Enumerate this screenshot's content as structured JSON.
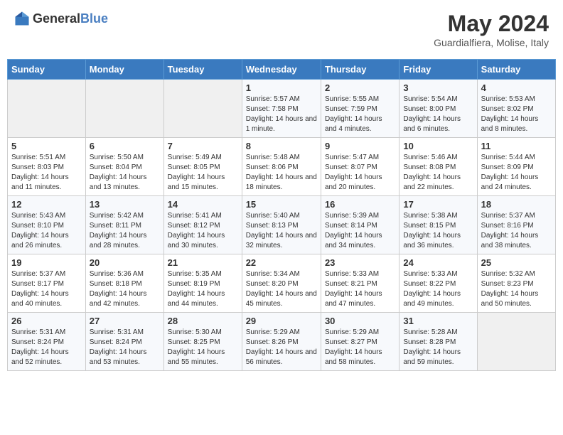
{
  "header": {
    "logo_general": "General",
    "logo_blue": "Blue",
    "title": "May 2024",
    "subtitle": "Guardialfiera, Molise, Italy"
  },
  "days_of_week": [
    "Sunday",
    "Monday",
    "Tuesday",
    "Wednesday",
    "Thursday",
    "Friday",
    "Saturday"
  ],
  "weeks": [
    [
      {
        "day": "",
        "info": ""
      },
      {
        "day": "",
        "info": ""
      },
      {
        "day": "",
        "info": ""
      },
      {
        "day": "1",
        "info": "Sunrise: 5:57 AM\nSunset: 7:58 PM\nDaylight: 14 hours and 1 minute."
      },
      {
        "day": "2",
        "info": "Sunrise: 5:55 AM\nSunset: 7:59 PM\nDaylight: 14 hours and 4 minutes."
      },
      {
        "day": "3",
        "info": "Sunrise: 5:54 AM\nSunset: 8:00 PM\nDaylight: 14 hours and 6 minutes."
      },
      {
        "day": "4",
        "info": "Sunrise: 5:53 AM\nSunset: 8:02 PM\nDaylight: 14 hours and 8 minutes."
      }
    ],
    [
      {
        "day": "5",
        "info": "Sunrise: 5:51 AM\nSunset: 8:03 PM\nDaylight: 14 hours and 11 minutes."
      },
      {
        "day": "6",
        "info": "Sunrise: 5:50 AM\nSunset: 8:04 PM\nDaylight: 14 hours and 13 minutes."
      },
      {
        "day": "7",
        "info": "Sunrise: 5:49 AM\nSunset: 8:05 PM\nDaylight: 14 hours and 15 minutes."
      },
      {
        "day": "8",
        "info": "Sunrise: 5:48 AM\nSunset: 8:06 PM\nDaylight: 14 hours and 18 minutes."
      },
      {
        "day": "9",
        "info": "Sunrise: 5:47 AM\nSunset: 8:07 PM\nDaylight: 14 hours and 20 minutes."
      },
      {
        "day": "10",
        "info": "Sunrise: 5:46 AM\nSunset: 8:08 PM\nDaylight: 14 hours and 22 minutes."
      },
      {
        "day": "11",
        "info": "Sunrise: 5:44 AM\nSunset: 8:09 PM\nDaylight: 14 hours and 24 minutes."
      }
    ],
    [
      {
        "day": "12",
        "info": "Sunrise: 5:43 AM\nSunset: 8:10 PM\nDaylight: 14 hours and 26 minutes."
      },
      {
        "day": "13",
        "info": "Sunrise: 5:42 AM\nSunset: 8:11 PM\nDaylight: 14 hours and 28 minutes."
      },
      {
        "day": "14",
        "info": "Sunrise: 5:41 AM\nSunset: 8:12 PM\nDaylight: 14 hours and 30 minutes."
      },
      {
        "day": "15",
        "info": "Sunrise: 5:40 AM\nSunset: 8:13 PM\nDaylight: 14 hours and 32 minutes."
      },
      {
        "day": "16",
        "info": "Sunrise: 5:39 AM\nSunset: 8:14 PM\nDaylight: 14 hours and 34 minutes."
      },
      {
        "day": "17",
        "info": "Sunrise: 5:38 AM\nSunset: 8:15 PM\nDaylight: 14 hours and 36 minutes."
      },
      {
        "day": "18",
        "info": "Sunrise: 5:37 AM\nSunset: 8:16 PM\nDaylight: 14 hours and 38 minutes."
      }
    ],
    [
      {
        "day": "19",
        "info": "Sunrise: 5:37 AM\nSunset: 8:17 PM\nDaylight: 14 hours and 40 minutes."
      },
      {
        "day": "20",
        "info": "Sunrise: 5:36 AM\nSunset: 8:18 PM\nDaylight: 14 hours and 42 minutes."
      },
      {
        "day": "21",
        "info": "Sunrise: 5:35 AM\nSunset: 8:19 PM\nDaylight: 14 hours and 44 minutes."
      },
      {
        "day": "22",
        "info": "Sunrise: 5:34 AM\nSunset: 8:20 PM\nDaylight: 14 hours and 45 minutes."
      },
      {
        "day": "23",
        "info": "Sunrise: 5:33 AM\nSunset: 8:21 PM\nDaylight: 14 hours and 47 minutes."
      },
      {
        "day": "24",
        "info": "Sunrise: 5:33 AM\nSunset: 8:22 PM\nDaylight: 14 hours and 49 minutes."
      },
      {
        "day": "25",
        "info": "Sunrise: 5:32 AM\nSunset: 8:23 PM\nDaylight: 14 hours and 50 minutes."
      }
    ],
    [
      {
        "day": "26",
        "info": "Sunrise: 5:31 AM\nSunset: 8:24 PM\nDaylight: 14 hours and 52 minutes."
      },
      {
        "day": "27",
        "info": "Sunrise: 5:31 AM\nSunset: 8:24 PM\nDaylight: 14 hours and 53 minutes."
      },
      {
        "day": "28",
        "info": "Sunrise: 5:30 AM\nSunset: 8:25 PM\nDaylight: 14 hours and 55 minutes."
      },
      {
        "day": "29",
        "info": "Sunrise: 5:29 AM\nSunset: 8:26 PM\nDaylight: 14 hours and 56 minutes."
      },
      {
        "day": "30",
        "info": "Sunrise: 5:29 AM\nSunset: 8:27 PM\nDaylight: 14 hours and 58 minutes."
      },
      {
        "day": "31",
        "info": "Sunrise: 5:28 AM\nSunset: 8:28 PM\nDaylight: 14 hours and 59 minutes."
      },
      {
        "day": "",
        "info": ""
      }
    ]
  ]
}
